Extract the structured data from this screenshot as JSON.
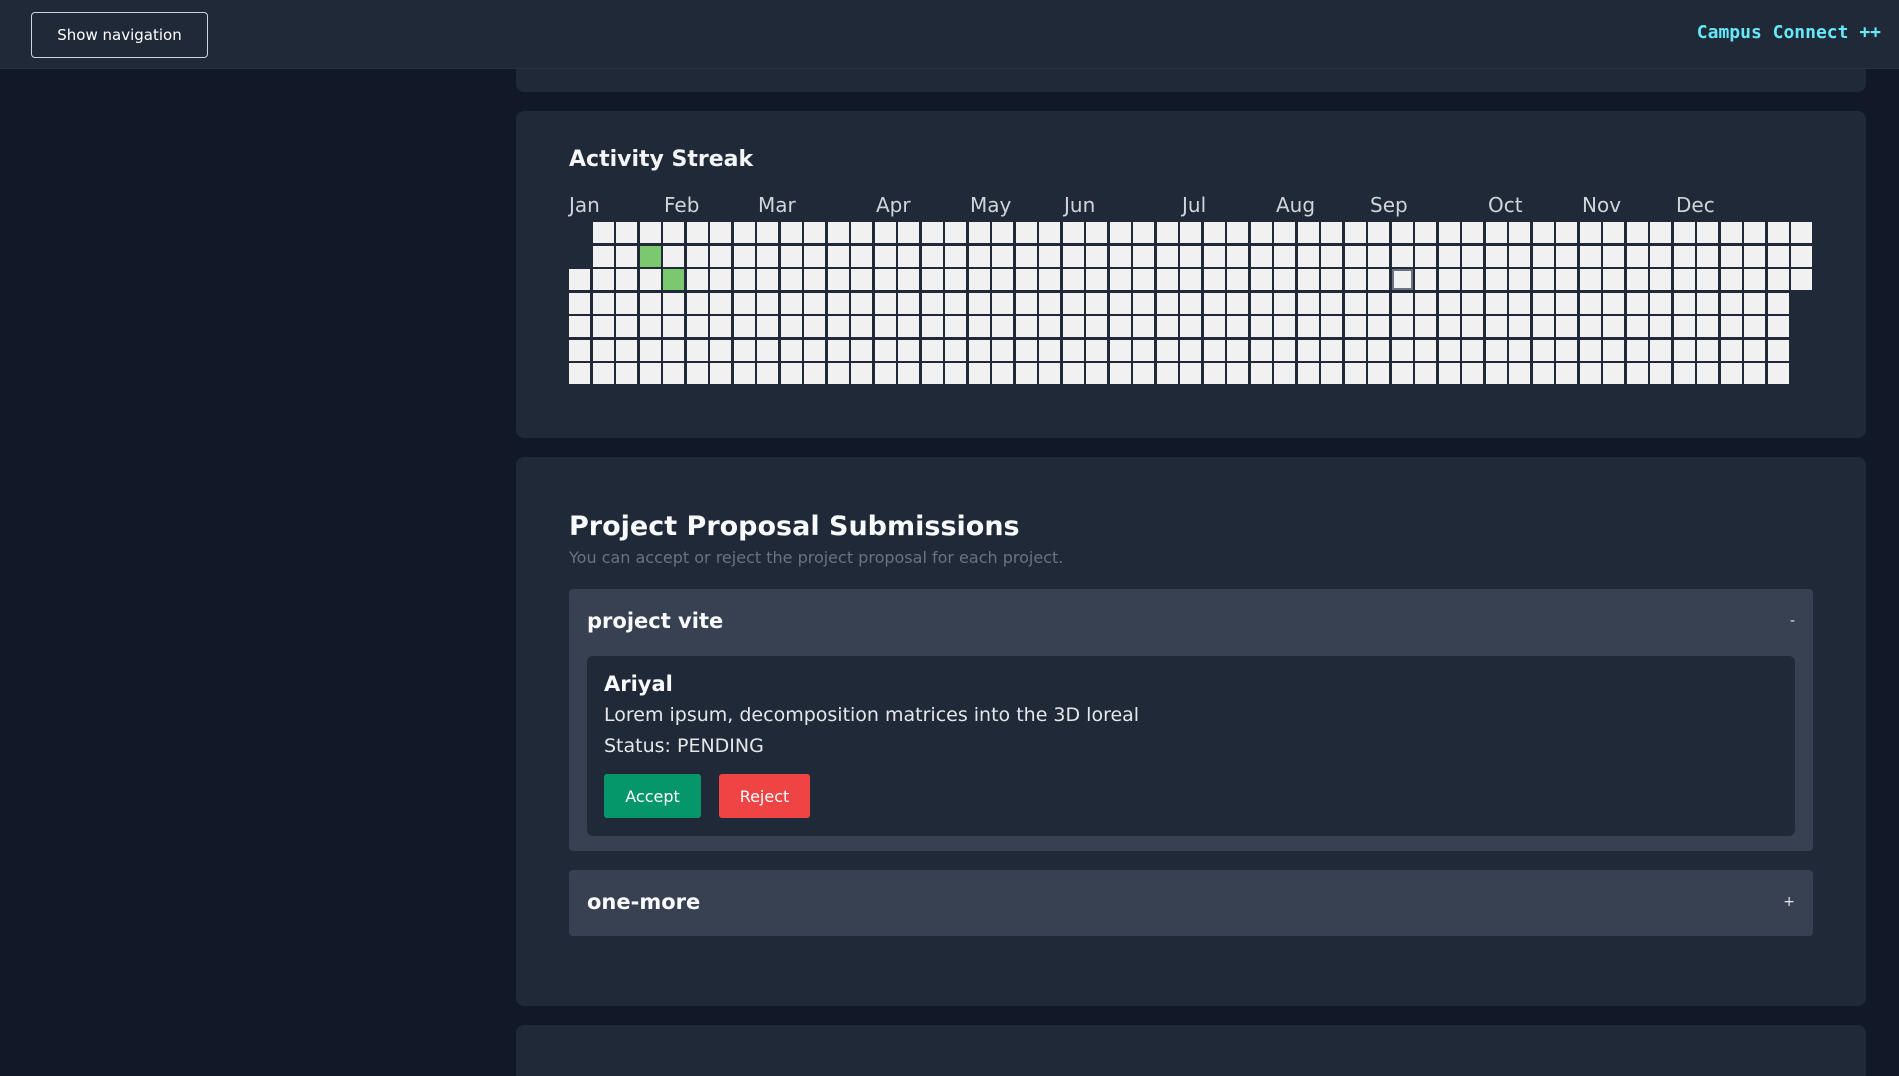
{
  "header": {
    "nav_button_label": "Show navigation",
    "brand": "Campus Connect ++"
  },
  "activity": {
    "title": "Activity Streak",
    "months": [
      "Jan",
      "Feb",
      "Mar",
      "Apr",
      "May",
      "Jun",
      "Jul",
      "Aug",
      "Sep",
      "Oct",
      "Nov",
      "Dec"
    ],
    "active_days": [
      {
        "week": 3,
        "day": 1
      },
      {
        "week": 4,
        "day": 2
      }
    ],
    "highlighted_day": {
      "week": 35,
      "day": 2
    },
    "colors": {
      "empty": "#f1f1f1",
      "active": "#7bc96f"
    }
  },
  "proposals": {
    "title": "Project Proposal Submissions",
    "subtitle": "You can accept or reject the project proposal for each project.",
    "projects": [
      {
        "name": "project vite",
        "toggle": "-",
        "submissions": [
          {
            "name": "Ariyal",
            "description": "Lorem ipsum, decomposition matrices into the 3D loreal",
            "status": "Status: PENDING",
            "accept_label": "Accept",
            "reject_label": "Reject"
          }
        ]
      },
      {
        "name": "one-more",
        "toggle": "+"
      }
    ]
  }
}
